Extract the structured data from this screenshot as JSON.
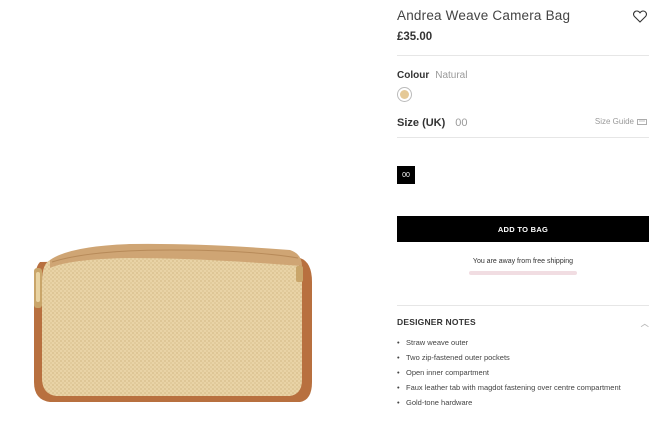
{
  "product": {
    "title": "Andrea Weave Camera Bag",
    "price": "£35.00"
  },
  "colour": {
    "label": "Colour",
    "value": "Natural",
    "swatch_color": "#e5c996"
  },
  "size": {
    "label": "Size (UK)",
    "value": "00",
    "guide_label": "Size Guide",
    "options": [
      "00"
    ]
  },
  "cart": {
    "add_label": "ADD TO BAG",
    "shipping_text": "You are away from free shipping"
  },
  "designer_notes": {
    "heading": "DESIGNER NOTES",
    "items": [
      "Straw weave outer",
      "Two zip-fastened outer pockets",
      "Open inner compartment",
      "Faux leather tab with magdot fastening over centre compartment",
      "Gold-tone hardware"
    ]
  },
  "icons": {
    "wishlist": "heart-icon",
    "size_guide": "ruler-icon",
    "notes_toggle": "chevron-up-icon"
  }
}
